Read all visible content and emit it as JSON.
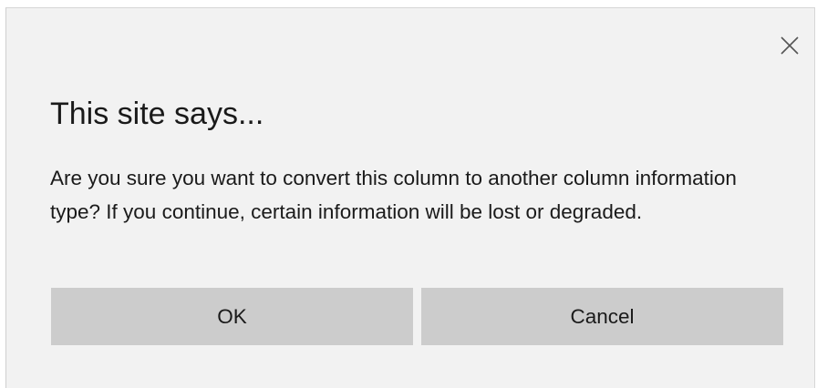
{
  "dialog": {
    "title": "This site says...",
    "message": "Are you sure you want to convert this column to another column information type? If you continue, certain information will be lost or degraded.",
    "close_icon": "close-icon",
    "buttons": {
      "ok_label": "OK",
      "cancel_label": "Cancel"
    }
  },
  "colors": {
    "dialog_background": "#f2f2f2",
    "button_background": "#cccccc",
    "text": "#1a1a1a"
  }
}
